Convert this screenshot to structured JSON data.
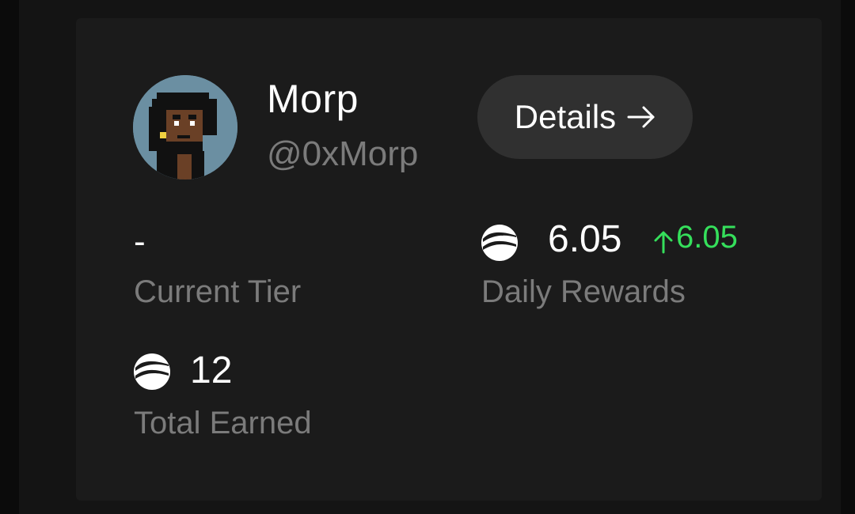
{
  "profile": {
    "name": "Morp",
    "handle": "@0xMorp",
    "avatar_icon": "pixel-punk-avatar"
  },
  "actions": {
    "details_label": "Details",
    "details_icon": "arrow-right-icon"
  },
  "stats": {
    "current_tier": {
      "value": "-",
      "label": "Current Tier"
    },
    "daily_rewards": {
      "value": "6.05",
      "change": "6.05",
      "label": "Daily Rewards",
      "token_icon": "token-coin-icon",
      "change_icon": "up-arrow-icon"
    },
    "total_earned": {
      "value": "12",
      "label": "Total Earned",
      "token_icon": "token-coin-icon"
    }
  },
  "colors": {
    "background": "#0b0b0b",
    "card": "#1b1b1b",
    "button": "#303030",
    "muted_text": "#7b7b7b",
    "positive": "#35df5b"
  }
}
